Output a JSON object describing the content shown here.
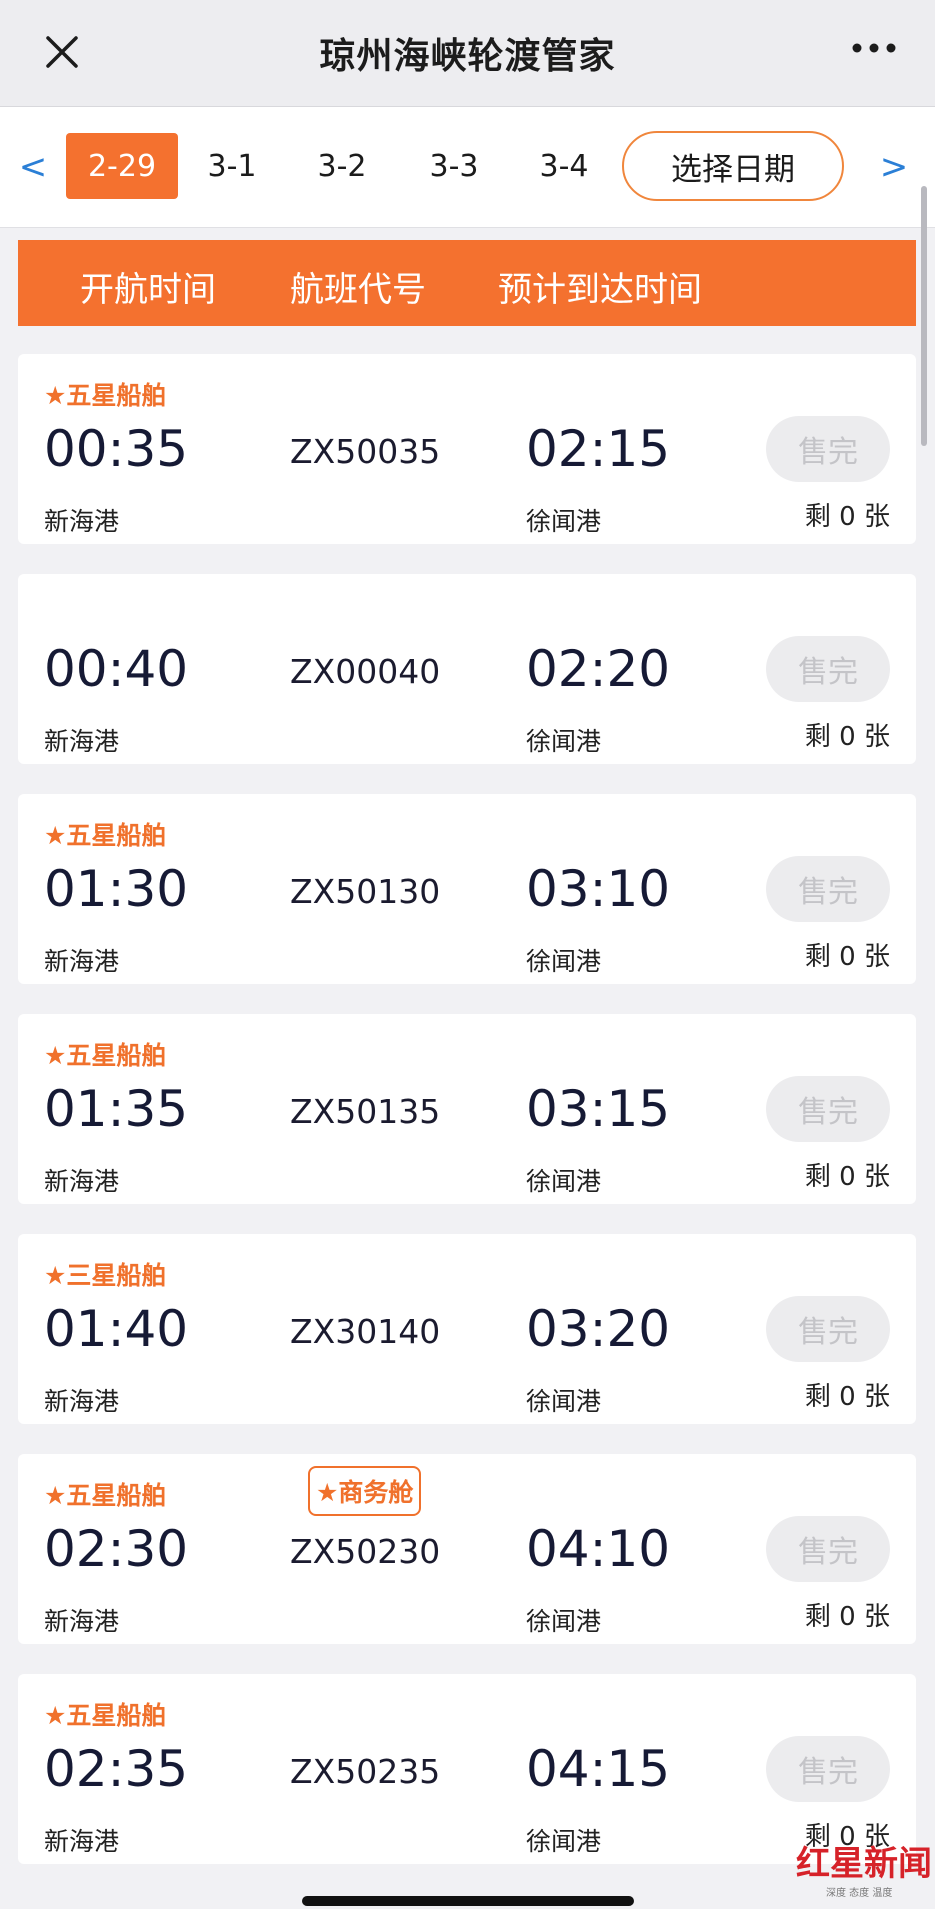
{
  "app": {
    "title": "琼州海峡轮渡管家"
  },
  "date_bar": {
    "prev": "<",
    "next": ">",
    "tabs": [
      "2-29",
      "3-1",
      "3-2",
      "3-3",
      "3-4"
    ],
    "active_index": 0,
    "pick_label": "选择日期"
  },
  "header": {
    "departure": "开航时间",
    "code": "航班代号",
    "arrival": "预计到达时间"
  },
  "flights": [
    {
      "tag": "★五星船舶",
      "badge": "",
      "dep": "00:35",
      "code": "ZX50035",
      "arr": "02:15",
      "dep_port": "新海港",
      "arr_port": "徐闻港",
      "status": "售完",
      "remain": "剩 0 张"
    },
    {
      "tag": "",
      "badge": "",
      "dep": "00:40",
      "code": "ZX00040",
      "arr": "02:20",
      "dep_port": "新海港",
      "arr_port": "徐闻港",
      "status": "售完",
      "remain": "剩 0 张"
    },
    {
      "tag": "★五星船舶",
      "badge": "",
      "dep": "01:30",
      "code": "ZX50130",
      "arr": "03:10",
      "dep_port": "新海港",
      "arr_port": "徐闻港",
      "status": "售完",
      "remain": "剩 0 张"
    },
    {
      "tag": "★五星船舶",
      "badge": "",
      "dep": "01:35",
      "code": "ZX50135",
      "arr": "03:15",
      "dep_port": "新海港",
      "arr_port": "徐闻港",
      "status": "售完",
      "remain": "剩 0 张"
    },
    {
      "tag": "★三星船舶",
      "badge": "",
      "dep": "01:40",
      "code": "ZX30140",
      "arr": "03:20",
      "dep_port": "新海港",
      "arr_port": "徐闻港",
      "status": "售完",
      "remain": "剩 0 张"
    },
    {
      "tag": "★五星船舶",
      "badge": "★商务舱",
      "dep": "02:30",
      "code": "ZX50230",
      "arr": "04:10",
      "dep_port": "新海港",
      "arr_port": "徐闻港",
      "status": "售完",
      "remain": "剩 0 张"
    },
    {
      "tag": "★五星船舶",
      "badge": "",
      "dep": "02:35",
      "code": "ZX50235",
      "arr": "04:15",
      "dep_port": "新海港",
      "arr_port": "徐闻港",
      "status": "售完",
      "remain": "剩 0 张"
    }
  ],
  "watermark": {
    "brand": "红星新闻",
    "sub": "深度 态度 温度"
  },
  "colors": {
    "accent": "#f4712f",
    "tag": "#f0712c",
    "link": "#2b7fd6"
  }
}
